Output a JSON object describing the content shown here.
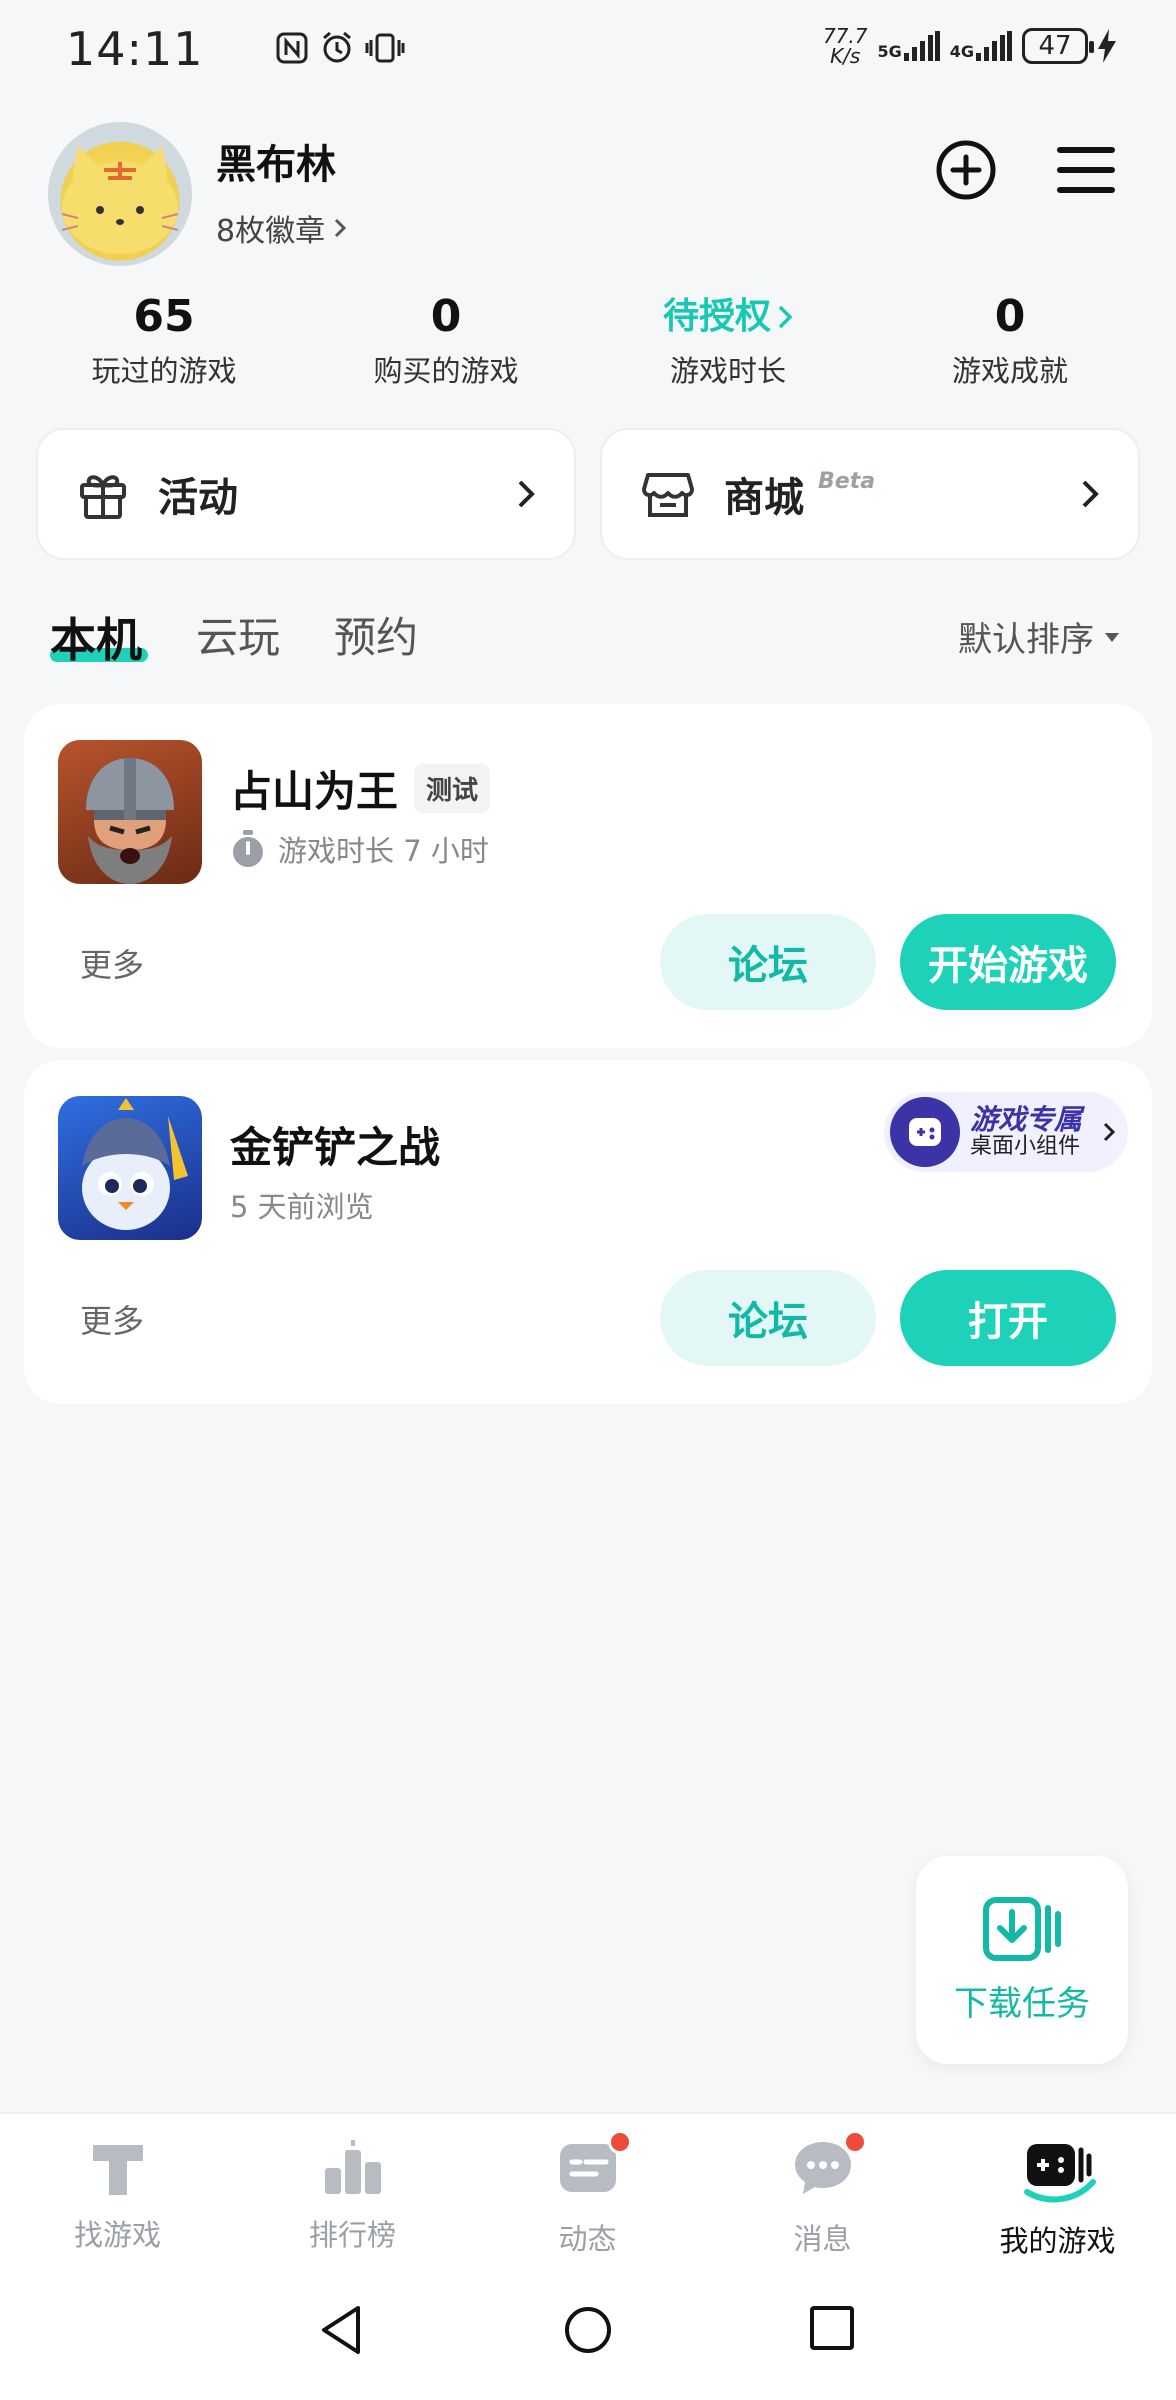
{
  "status_bar": {
    "time": "14:11",
    "net_speed_value": "77.7",
    "net_speed_unit": "K/s",
    "sim1_label": "5G",
    "sim2_label": "4G",
    "battery": "47"
  },
  "profile": {
    "name": "黑布林",
    "badges": "8枚徽章"
  },
  "stats": [
    {
      "value": "65",
      "label": "玩过的游戏"
    },
    {
      "value": "0",
      "label": "购买的游戏"
    },
    {
      "value": "待授权",
      "label": "游戏时长"
    },
    {
      "value": "0",
      "label": "游戏成就"
    }
  ],
  "entries": {
    "activity": "活动",
    "mall": "商城",
    "mall_badge": "Beta"
  },
  "tabs": [
    "本机",
    "云玩",
    "预约"
  ],
  "sort_label": "默认排序",
  "games": [
    {
      "title": "占山为王",
      "tag": "测试",
      "meta": "游戏时长 7 小时",
      "more": "更多",
      "forum": "论坛",
      "action": "开始游戏"
    },
    {
      "title": "金铲铲之战",
      "meta": "5 天前浏览",
      "more": "更多",
      "forum": "论坛",
      "action": "打开",
      "widget_main": "游戏专属",
      "widget_sub": "桌面小组件"
    }
  ],
  "download_label": "下载任务",
  "bottom_nav": [
    {
      "label": "找游戏",
      "active": false
    },
    {
      "label": "排行榜",
      "active": false
    },
    {
      "label": "动态",
      "active": false
    },
    {
      "label": "消息",
      "active": false
    },
    {
      "label": "我的游戏",
      "active": true
    }
  ],
  "colors": {
    "accent": "#1ed1b9",
    "background": "#f5f7f9",
    "notification": "#f04a3c"
  }
}
